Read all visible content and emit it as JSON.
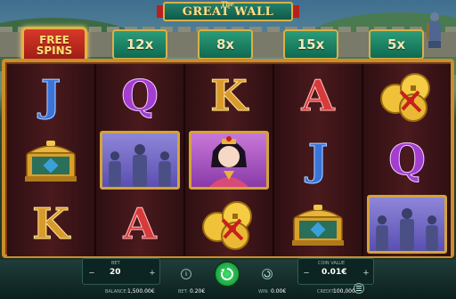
{
  "title": {
    "the": "The",
    "name": "GREAT WALL"
  },
  "free_spins": {
    "line1": "FREE",
    "line2": "SPINS"
  },
  "multipliers": [
    "12x",
    "8x",
    "15x",
    "5x"
  ],
  "reels": [
    [
      {
        "type": "letter",
        "value": "J"
      },
      {
        "type": "chest"
      },
      {
        "type": "letter",
        "value": "K"
      }
    ],
    [
      {
        "type": "letter",
        "value": "Q"
      },
      {
        "type": "warriors"
      },
      {
        "type": "letter",
        "value": "A"
      }
    ],
    [
      {
        "type": "letter",
        "value": "K"
      },
      {
        "type": "princess"
      },
      {
        "type": "coins"
      }
    ],
    [
      {
        "type": "letter",
        "value": "A"
      },
      {
        "type": "letter",
        "value": "J"
      },
      {
        "type": "chest"
      }
    ],
    [
      {
        "type": "coins"
      },
      {
        "type": "letter",
        "value": "Q"
      },
      {
        "type": "warriors"
      }
    ]
  ],
  "bet_panel": {
    "bet_label": "BET",
    "bet_value": "20",
    "coin_value_label": "COIN VALUE",
    "coin_value": "0.01€"
  },
  "footer": {
    "balance_label": "BALANCE:",
    "balance_value": "1,500.00€",
    "bet_label": "BET:",
    "bet_value": "0.20€",
    "win_label": "WIN:",
    "win_value": "0.00€",
    "credit_label": "CREDIT:",
    "credit_value": "100,000"
  },
  "colors": {
    "accent": "#d4a33a",
    "spin_button": "#1fb84a",
    "frame": "#c98d2e"
  }
}
